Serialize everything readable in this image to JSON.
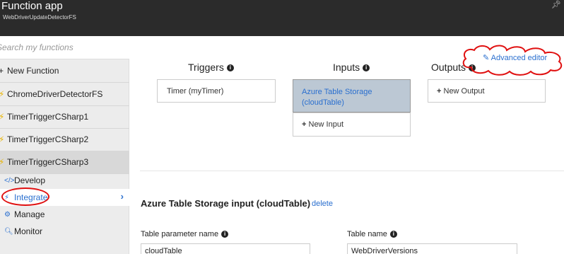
{
  "header": {
    "title": "Function app",
    "subtitle": "WebDriverUpdateDetectorFS",
    "pin_icon": "pin-icon"
  },
  "sidebar": {
    "search_placeholder": "Search my functions",
    "items": [
      {
        "label": "New Function",
        "icon": "plus-icon"
      },
      {
        "label": "ChromeDriverDetectorFS",
        "icon": "bolt-icon"
      },
      {
        "label": "TimerTriggerCSharp1",
        "icon": "bolt-icon"
      },
      {
        "label": "TimerTriggerCSharp2",
        "icon": "bolt-icon"
      },
      {
        "label": "TimerTriggerCSharp3",
        "icon": "bolt-icon"
      }
    ],
    "subitems": [
      {
        "label": "Develop",
        "icon": "code-icon"
      },
      {
        "label": "Integrate",
        "icon": "bolt-icon"
      },
      {
        "label": "Manage",
        "icon": "gear-icon"
      },
      {
        "label": "Monitor",
        "icon": "search-icon"
      }
    ]
  },
  "main": {
    "triggers_title": "Triggers",
    "inputs_title": "Inputs",
    "outputs_title": "Outputs",
    "trigger_box": "Timer (myTimer)",
    "input_box": "Azure Table Storage (cloudTable)",
    "new_input": "New Input",
    "new_output": "New Output",
    "advanced_editor": "Advanced editor",
    "section_title": "Azure Table Storage input (cloudTable)",
    "delete_label": "delete",
    "table_param_label": "Table parameter name",
    "table_param_value": "cloudTable",
    "table_name_label": "Table name",
    "table_name_value": "WebDriverVersions"
  },
  "colors": {
    "header_bg": "#2b2b2b",
    "accent": "#2a6fcf",
    "annotation": "#e01010",
    "selected_input_bg": "#bcc8d4"
  }
}
